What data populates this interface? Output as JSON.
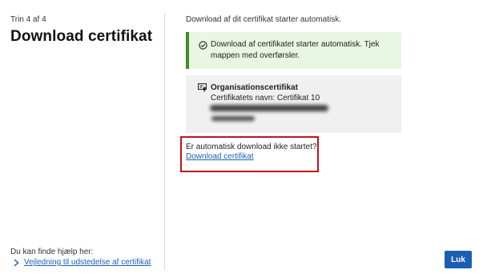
{
  "wizard": {
    "step_label": "Trin 4 af 4",
    "title": "Download certifikat"
  },
  "help": {
    "text": "Du kan finde hjælp her:",
    "link": "Vejledning til udstedelse af certifikat"
  },
  "main": {
    "intro": "Download af dit certifikat starter automatisk.",
    "success_message": "Download af certifikatet starter automatisk. Tjek mappen med overførsler.",
    "certificate": {
      "type": "Organisationscertifikat",
      "name_label": "Certifikatets navn: Certifikat 10"
    },
    "question": "Er automatisk download ikke startet?",
    "download_link": "Download certifikat"
  },
  "actions": {
    "close_label": "Luk"
  },
  "colors": {
    "accent": "#1a5fb4",
    "success_bg": "#e9f6e1",
    "success_border": "#3a8f26",
    "highlight": "#c0141b"
  },
  "icons": {
    "success": "check-circle-icon",
    "certificate": "certificate-icon",
    "help_link": "chevron-right-icon"
  }
}
